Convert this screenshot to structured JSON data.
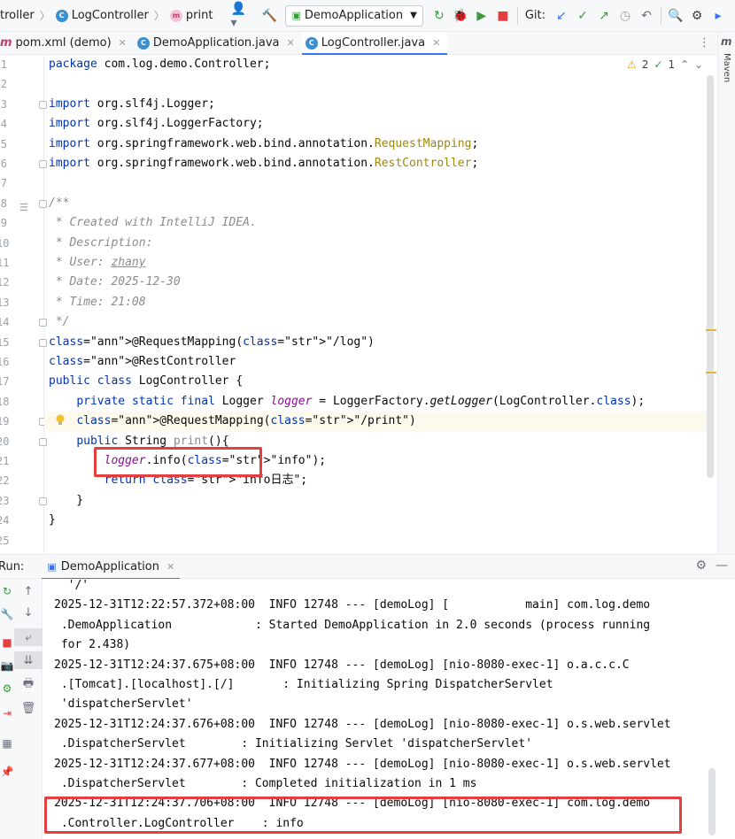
{
  "toolbar": {
    "breadcrumb": [
      {
        "label": "troller",
        "icon": ""
      },
      {
        "label": "LogController",
        "icon": "class-icon"
      },
      {
        "label": "print",
        "icon": "method-icon"
      }
    ],
    "run_config": "DemoApplication",
    "git_label": "Git:"
  },
  "tabs": [
    {
      "label": "pom.xml (demo)",
      "icon": "maven-icon",
      "active": false
    },
    {
      "label": "DemoApplication.java",
      "icon": "class-icon",
      "active": false
    },
    {
      "label": "LogController.java",
      "icon": "class-icon",
      "active": true
    }
  ],
  "right_strip": {
    "label": "Maven"
  },
  "inspections": {
    "warnings": "2",
    "checks": "1"
  },
  "editor": {
    "line_numbers": [
      "1",
      "2",
      "3",
      "4",
      "5",
      "6",
      "7",
      "8",
      "9",
      "10",
      "11",
      "12",
      "13",
      "14",
      "15",
      "16",
      "17",
      "18",
      "19",
      "20",
      "21",
      "22",
      "23",
      "24",
      "25"
    ],
    "lines": [
      "package com.log.demo.Controller;",
      "",
      "import org.slf4j.Logger;",
      "import org.slf4j.LoggerFactory;",
      "import org.springframework.web.bind.annotation.RequestMapping;",
      "import org.springframework.web.bind.annotation.RestController;",
      "",
      "/**",
      " * Created with IntelliJ IDEA.",
      " * Description:",
      " * User: zhany",
      " * Date: 2025-12-30",
      " * Time: 21:08",
      " */",
      "@RequestMapping(\"/log\")",
      "@RestController",
      "public class LogController {",
      "    private static final Logger logger = LoggerFactory.getLogger(LogController.class);",
      "    @RequestMapping(\"/print\")",
      "    public String print(){",
      "        logger.info(\"info\");",
      "        return \"info日志\";",
      "    }",
      "}",
      ""
    ]
  },
  "run_panel": {
    "label": "Run:",
    "tab": "DemoApplication",
    "console_lines": [
      "  '/'",
      "2025-12-31T12:22:57.372+08:00  INFO 12748 --- [demoLog] [           main] com.log.demo",
      " .DemoApplication            : Started DemoApplication in 2.0 seconds (process running",
      " for 2.438)",
      "2025-12-31T12:24:37.675+08:00  INFO 12748 --- [demoLog] [nio-8080-exec-1] o.a.c.c.C",
      " .[Tomcat].[localhost].[/]       : Initializing Spring DispatcherServlet",
      " 'dispatcherServlet'",
      "2025-12-31T12:24:37.676+08:00  INFO 12748 --- [demoLog] [nio-8080-exec-1] o.s.web.servlet",
      " .DispatcherServlet        : Initializing Servlet 'dispatcherServlet'",
      "2025-12-31T12:24:37.677+08:00  INFO 12748 --- [demoLog] [nio-8080-exec-1] o.s.web.servlet",
      " .DispatcherServlet        : Completed initialization in 1 ms",
      "2025-12-31T12:24:37.706+08:00  INFO 12748 --- [demoLog] [nio-8080-exec-1] com.log.demo",
      " .Controller.LogController    : info"
    ]
  },
  "colors": {
    "accent": "#3574f0",
    "highlight_box": "#e53e3e",
    "keyword": "#0033b3",
    "annotation": "#9e880d",
    "string": "#067d17"
  }
}
